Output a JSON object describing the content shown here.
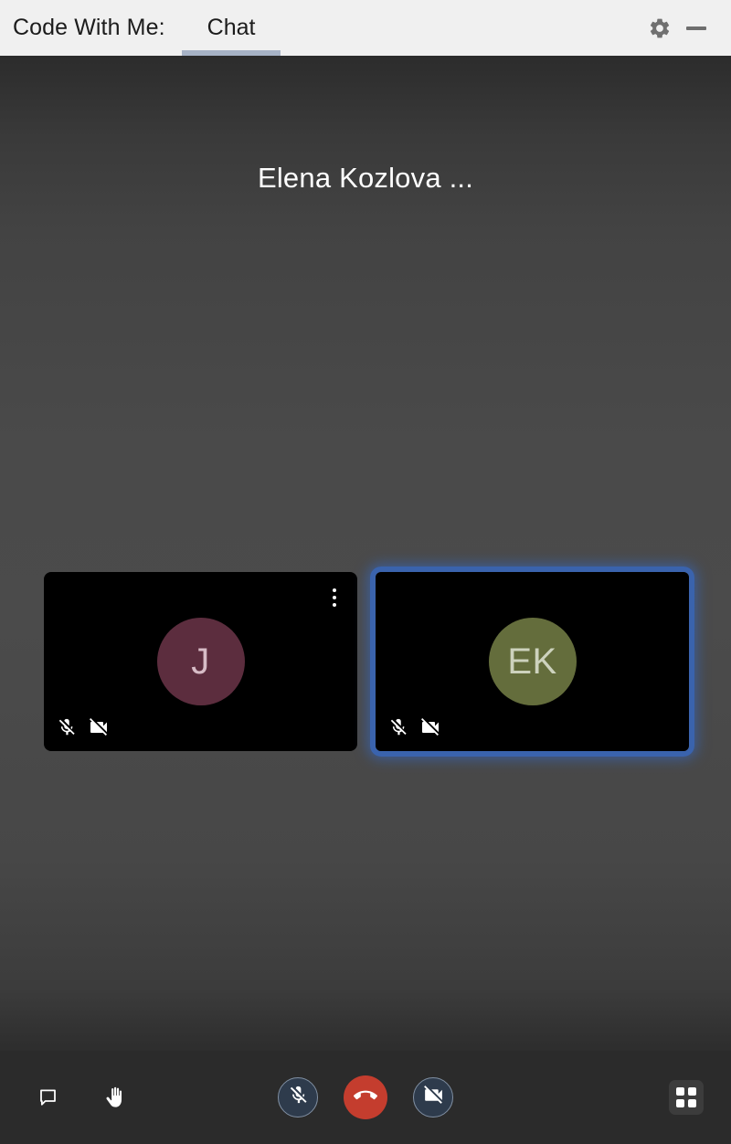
{
  "titlebar": {
    "app_title": "Code With Me:",
    "tabs": [
      {
        "label": "Chat",
        "active": true
      }
    ],
    "settings_icon": "gear-icon",
    "minimize_icon": "minimize-icon"
  },
  "meeting": {
    "title": "Elena Kozlova ...",
    "participants": [
      {
        "initials": "J",
        "avatar_color": "#5c2d3e",
        "initials_color": "#d7bcc6",
        "mic_muted": true,
        "camera_off": true,
        "active_speaker": false,
        "has_menu": true,
        "menu_icon": "more-vertical-icon",
        "mic_icon": "mic-off-icon",
        "camera_icon": "camera-off-icon"
      },
      {
        "initials": "EK",
        "avatar_color": "#646d3c",
        "initials_color": "#cdd2bd",
        "mic_muted": true,
        "camera_off": true,
        "active_speaker": true,
        "has_menu": false,
        "menu_icon": "more-vertical-icon",
        "mic_icon": "mic-off-icon",
        "camera_icon": "camera-off-icon"
      }
    ],
    "active_border_color": "#3a63ad"
  },
  "toolbar": {
    "chat_icon": "chat-bubble-icon",
    "raise_hand_icon": "raise-hand-icon",
    "mic_toggle_icon": "mic-off-icon",
    "hangup_icon": "end-call-icon",
    "camera_toggle_icon": "camera-off-icon",
    "layout_icon": "grid-layout-icon",
    "hangup_color": "#c43d2e",
    "toggle_color": "#2e3b4c"
  }
}
